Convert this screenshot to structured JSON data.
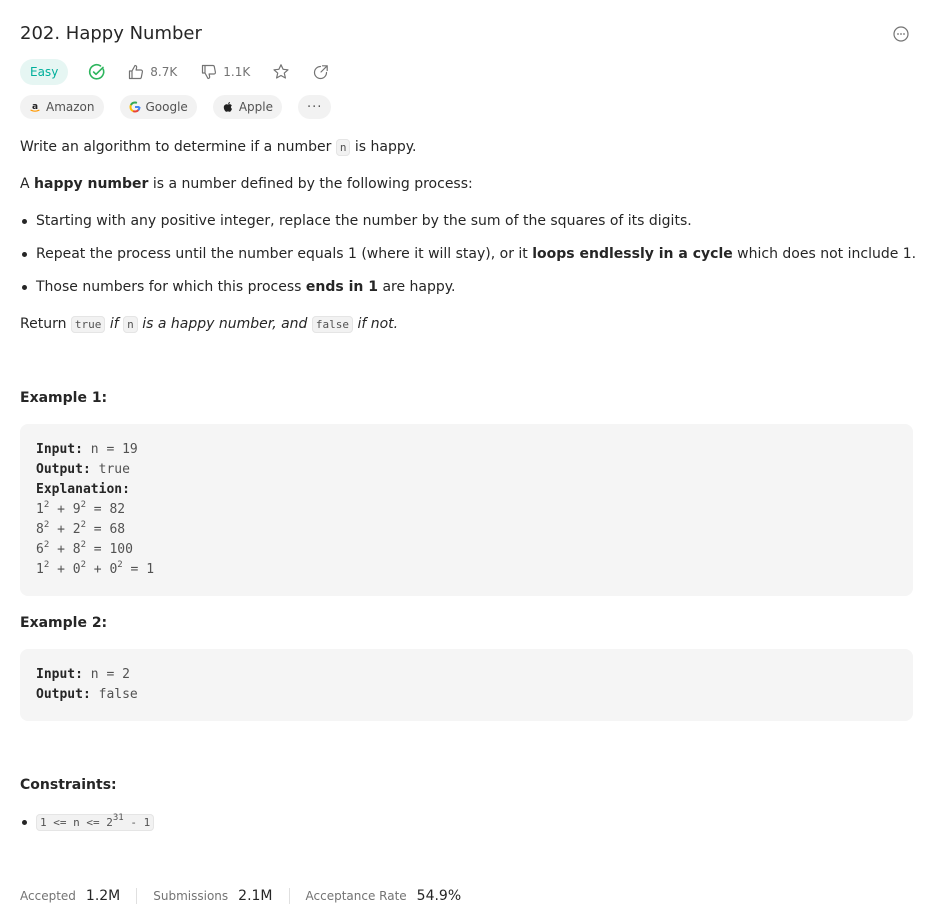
{
  "problem": {
    "title": "202. Happy Number",
    "difficulty": "Easy",
    "likes": "8.7K",
    "dislikes": "1.1K"
  },
  "companies": [
    "Amazon",
    "Google",
    "Apple"
  ],
  "more_label": "···",
  "description": {
    "intro_pre": "Write an algorithm to determine if a number ",
    "intro_code": "n",
    "intro_post": " is happy.",
    "def_a": "A ",
    "def_bold": "happy number",
    "def_post": " is a number defined by the following process:",
    "bullet1": "Starting with any positive integer, replace the number by the sum of the squares of its digits.",
    "bullet2_pre": "Repeat the process until the number equals 1 (where it will stay), or it ",
    "bullet2_bold": "loops endlessly in a cycle",
    "bullet2_post": " which does not include 1.",
    "bullet3_pre": "Those numbers for which this process ",
    "bullet3_bold": "ends in 1",
    "bullet3_post": " are happy.",
    "ret_pre": "Return ",
    "ret_code_true": "true",
    "ret_if": " if ",
    "ret_code_n": "n",
    "ret_mid": " is a happy number, and ",
    "ret_code_false": "false",
    "ret_post": " if not."
  },
  "examples": {
    "ex1_title": "Example 1:",
    "ex2_title": "Example 2:",
    "input_label": "Input:",
    "output_label": "Output:",
    "explanation_label": "Explanation:",
    "ex1_input": "n = 19",
    "ex1_output": "true",
    "ex2_input": "n = 2",
    "ex2_output": "false",
    "sq": "2",
    "e1": {
      "a": "1",
      "b": " + 9",
      "c": " = 82"
    },
    "e2": {
      "a": "8",
      "b": " + 2",
      "c": " = 68"
    },
    "e3": {
      "a": "6",
      "b": " + 8",
      "c": " = 100"
    },
    "e4": {
      "a": "1",
      "b": " + 0",
      "c": " + 0",
      "d": " = 1"
    }
  },
  "constraints": {
    "title": "Constraints:",
    "pre": "1 <= n <= 2",
    "exp": "31",
    "post": " - 1"
  },
  "stats": {
    "accepted_label": "Accepted",
    "accepted_value": "1.2M",
    "submissions_label": "Submissions",
    "submissions_value": "2.1M",
    "rate_label": "Acceptance Rate",
    "rate_value": "54.9%"
  },
  "colors": {
    "easy": "#00af9b",
    "solved": "#2db55d",
    "code_bg": "#f5f5f5"
  },
  "icons": [
    "more-icon",
    "solved-check-icon",
    "thumbs-up-icon",
    "thumbs-down-icon",
    "star-icon",
    "share-icon",
    "amazon-logo",
    "google-logo",
    "apple-logo"
  ]
}
